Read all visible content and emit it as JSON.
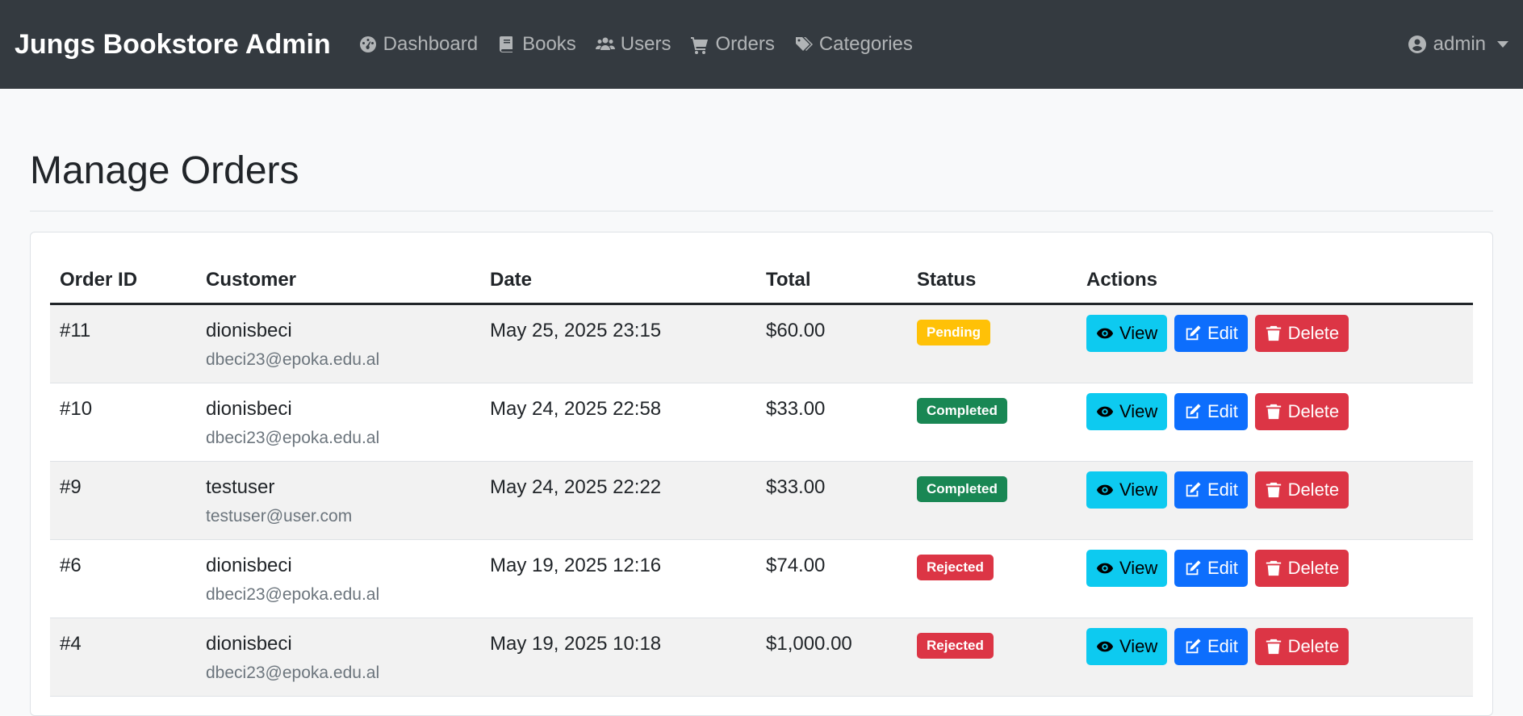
{
  "navbar": {
    "brand": "Jungs Bookstore Admin",
    "links": [
      {
        "label": "Dashboard",
        "icon": "dashboard-icon"
      },
      {
        "label": "Books",
        "icon": "book-icon"
      },
      {
        "label": "Users",
        "icon": "users-icon"
      },
      {
        "label": "Orders",
        "icon": "cart-icon"
      },
      {
        "label": "Categories",
        "icon": "tags-icon"
      }
    ],
    "user": {
      "label": "admin",
      "icon": "user-circle-icon"
    }
  },
  "page": {
    "title": "Manage Orders"
  },
  "table": {
    "headers": [
      "Order ID",
      "Customer",
      "Date",
      "Total",
      "Status",
      "Actions"
    ],
    "rows": [
      {
        "id": "#11",
        "customer": "dionisbeci",
        "email": "dbeci23@epoka.edu.al",
        "date": "May 25, 2025 23:15",
        "total": "$60.00",
        "status": "Pending"
      },
      {
        "id": "#10",
        "customer": "dionisbeci",
        "email": "dbeci23@epoka.edu.al",
        "date": "May 24, 2025 22:58",
        "total": "$33.00",
        "status": "Completed"
      },
      {
        "id": "#9",
        "customer": "testuser",
        "email": "testuser@user.com",
        "date": "May 24, 2025 22:22",
        "total": "$33.00",
        "status": "Completed"
      },
      {
        "id": "#6",
        "customer": "dionisbeci",
        "email": "dbeci23@epoka.edu.al",
        "date": "May 19, 2025 12:16",
        "total": "$74.00",
        "status": "Rejected"
      },
      {
        "id": "#4",
        "customer": "dionisbeci",
        "email": "dbeci23@epoka.edu.al",
        "date": "May 19, 2025 10:18",
        "total": "$1,000.00",
        "status": "Rejected"
      }
    ],
    "actions": {
      "view": "View",
      "edit": "Edit",
      "delete": "Delete"
    }
  },
  "colors": {
    "navbar_bg": "#343a40",
    "pending": "#ffc107",
    "completed": "#198754",
    "rejected": "#dc3545",
    "view_btn": "#0dcaf0",
    "edit_btn": "#0d6efd",
    "delete_btn": "#dc3545"
  }
}
